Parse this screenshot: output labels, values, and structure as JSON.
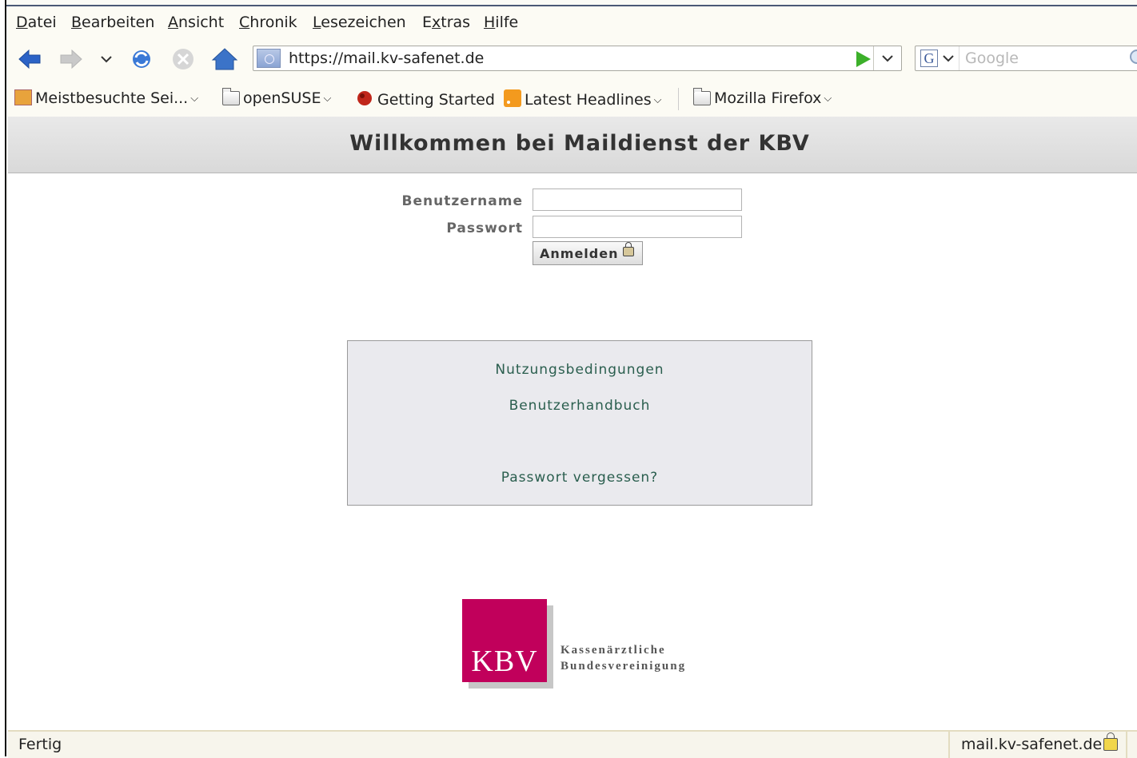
{
  "menu": {
    "items": [
      {
        "underline": "D",
        "rest": "atei"
      },
      {
        "underline": "B",
        "rest": "earbeiten"
      },
      {
        "underline": "A",
        "rest": "nsicht"
      },
      {
        "underline": "C",
        "rest": "hronik"
      },
      {
        "underline": "L",
        "rest": "esezeichen"
      },
      {
        "prefix": "E",
        "underline": "x",
        "rest": "tras"
      },
      {
        "underline": "H",
        "rest": "ilfe"
      }
    ]
  },
  "navbar": {
    "url": "https://mail.kv-safenet.de",
    "search_placeholder": "Google",
    "search_engine_letter": "G"
  },
  "bookmarks": [
    {
      "label": "Meistbesuchte Sei...",
      "icon": "most-visited-icon"
    },
    {
      "label": "openSUSE",
      "icon": "folder-icon"
    },
    {
      "label": "Getting Started",
      "icon": "firefox-icon"
    },
    {
      "label": "Latest Headlines",
      "icon": "rss-icon"
    },
    {
      "label": "Mozilla Firefox",
      "icon": "folder-icon"
    }
  ],
  "page": {
    "title": "Willkommen bei Maildienst der KBV",
    "username_label": "Benutzername",
    "password_label": "Passwort",
    "username_value": "",
    "password_value": "",
    "login_label": "Anmelden",
    "links": {
      "terms": "Nutzungsbedingungen",
      "manual": "Benutzerhandbuch",
      "forgot": "Passwort vergessen?"
    },
    "logo": {
      "letters": "KBV",
      "line1": "Kassenärztliche",
      "line2": "Bundesvereinigung",
      "color": "#c1005b"
    }
  },
  "status": {
    "text": "Fertig",
    "site": "mail.kv-safenet.de"
  }
}
